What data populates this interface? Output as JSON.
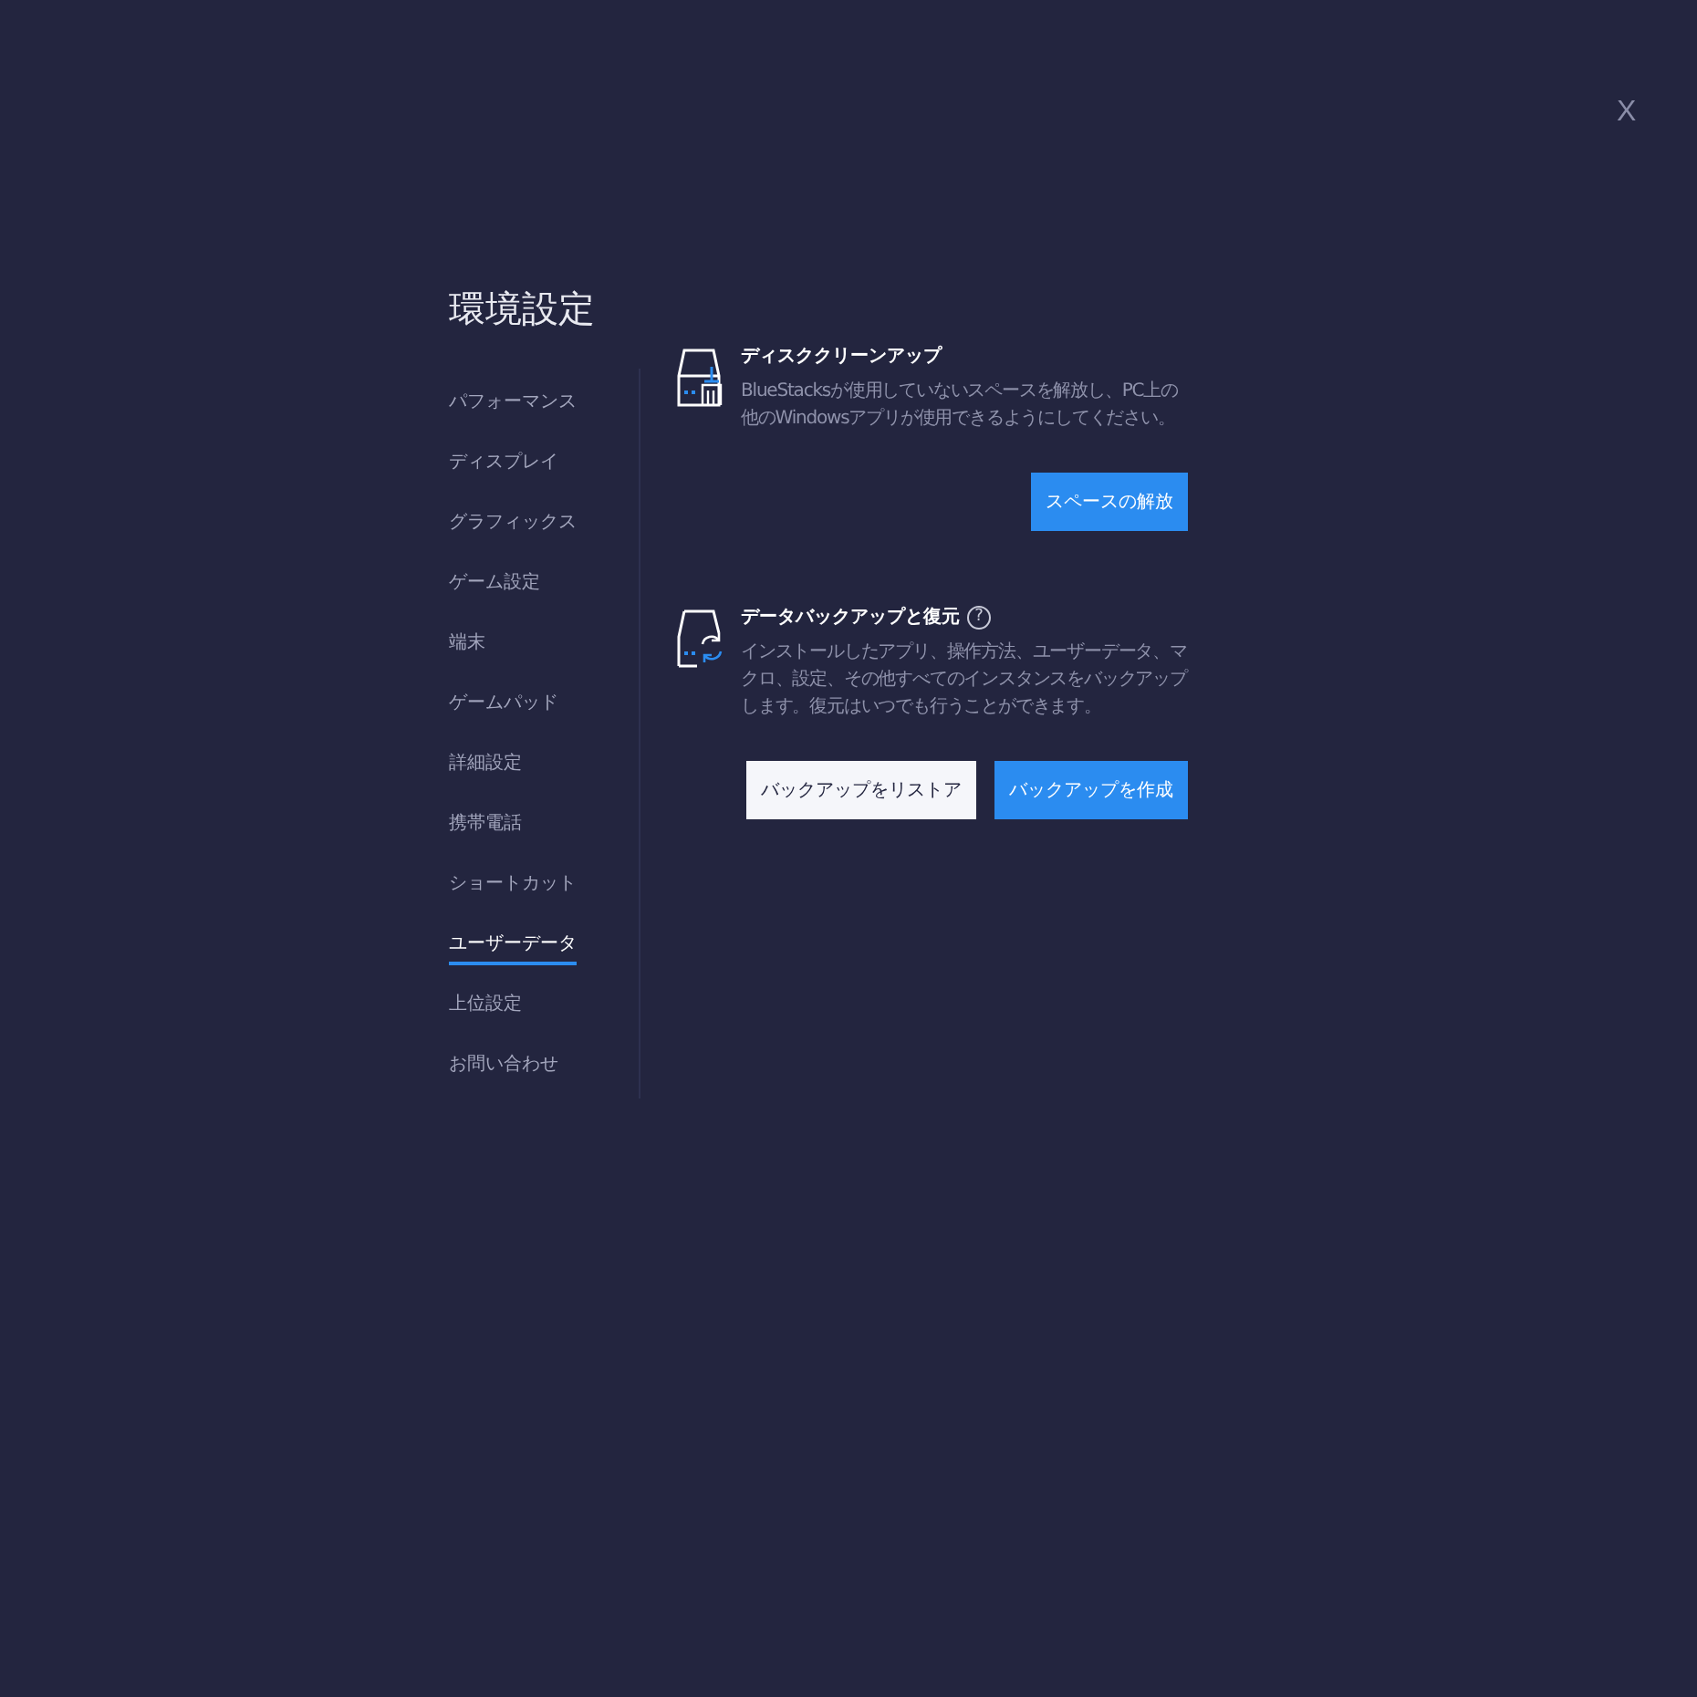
{
  "close": "X",
  "title": "環境設定",
  "sidebar": {
    "items": [
      {
        "label": "パフォーマンス",
        "selected": false
      },
      {
        "label": "ディスプレイ",
        "selected": false
      },
      {
        "label": "グラフィックス",
        "selected": false
      },
      {
        "label": "ゲーム設定",
        "selected": false
      },
      {
        "label": "端末",
        "selected": false
      },
      {
        "label": "ゲームパッド",
        "selected": false
      },
      {
        "label": "詳細設定",
        "selected": false
      },
      {
        "label": "携帯電話",
        "selected": false
      },
      {
        "label": "ショートカット",
        "selected": false
      },
      {
        "label": "ユーザーデータ",
        "selected": true
      },
      {
        "label": "上位設定",
        "selected": false
      },
      {
        "label": "お問い合わせ",
        "selected": false
      }
    ]
  },
  "sections": [
    {
      "kind": "cleanup",
      "title": "ディスククリーンアップ",
      "description": "BlueStacksが使用していないスペースを解放し、PC上の他のWindowsアプリが使用できるようにしてください。",
      "buttons": [
        {
          "label": "スペースの解放",
          "primary": true
        }
      ]
    },
    {
      "kind": "backup",
      "title": "データバックアップと復元",
      "help": "?",
      "description": "インストールしたアプリ、操作方法、ユーザーデータ、マクロ、設定、その他すべてのインスタンスをバックアップします。復元はいつでも行うことができます。",
      "buttons": [
        {
          "label": "バックアップをリストア",
          "primary": false
        },
        {
          "label": "バックアップを作成",
          "primary": true
        }
      ]
    }
  ]
}
